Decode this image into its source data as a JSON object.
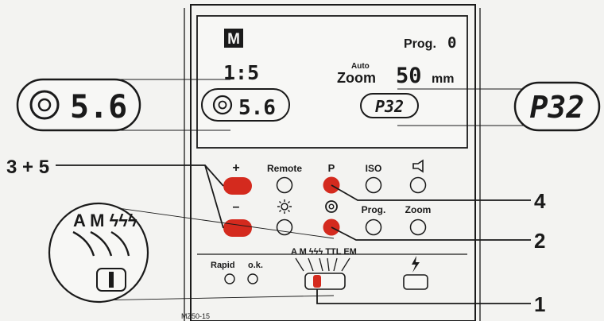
{
  "lcd": {
    "mode_letter": "M",
    "power_ratio": "1:5",
    "aperture_value": "5.6",
    "prog_label": "Prog.",
    "prog_value": "0",
    "auto_label": "Auto",
    "zoom_label": "Zoom",
    "zoom_value": "50",
    "zoom_unit": "mm",
    "program_display": "P32"
  },
  "buttons": {
    "plus": "+",
    "minus": "–",
    "remote": "Remote",
    "p": "P",
    "iso": "ISO",
    "prog": "Prog.",
    "zoom": "Zoom"
  },
  "slider": {
    "rapid": "Rapid",
    "ok": "o.k.",
    "mode_labels": "A M ϟϟϟ TTL EM"
  },
  "callouts": {
    "c35": "3 + 5",
    "c4": "4",
    "c2": "2",
    "c1": "1"
  },
  "zoom_left": {
    "modes": "A M ϟϟϟ"
  },
  "footer": {
    "code": "MZ50-15"
  },
  "colors": {
    "highlight": "#d42a1e",
    "ink": "#1a1a1a"
  }
}
